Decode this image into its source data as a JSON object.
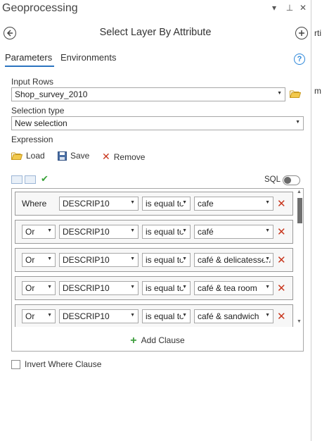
{
  "pane": {
    "title": "Geoprocessing",
    "title_buttons": [
      "▾",
      "⊥",
      "✕"
    ]
  },
  "tool": {
    "title": "Select Layer By Attribute",
    "back_icon": "back-arrow-icon",
    "add_icon": "plus-circle-icon"
  },
  "tabs": [
    {
      "label": "Parameters",
      "active": true
    },
    {
      "label": "Environments",
      "active": false
    }
  ],
  "help_icon": "?",
  "params": {
    "input_rows_label": "Input Rows",
    "input_rows_value": "Shop_survey_2010",
    "selection_type_label": "Selection type",
    "selection_type_value": "New selection",
    "expression_label": "Expression"
  },
  "expression_tools": {
    "load": "Load",
    "save": "Save",
    "remove": "Remove"
  },
  "sql": {
    "label": "SQL",
    "enabled": false
  },
  "clauses": [
    {
      "connector": "Where",
      "field": "DESCRIP10",
      "operator": "is equal to",
      "value": "cafe"
    },
    {
      "connector": "Or",
      "field": "DESCRIP10",
      "operator": "is equal to",
      "value": "café"
    },
    {
      "connector": "Or",
      "field": "DESCRIP10",
      "operator": "is equal to",
      "value": "café & delicatessen"
    },
    {
      "connector": "Or",
      "field": "DESCRIP10",
      "operator": "is equal to",
      "value": "café & tea room"
    },
    {
      "connector": "Or",
      "field": "DESCRIP10",
      "operator": "is equal to",
      "value": "café & sandwich"
    }
  ],
  "add_clause_label": "Add Clause",
  "invert_label": "Invert Where Clause",
  "colors": {
    "accent": "#2b74c0",
    "remove": "#c8361d",
    "add": "#3f9f3f"
  },
  "offpane_fragments": [
    "rti",
    "m"
  ]
}
